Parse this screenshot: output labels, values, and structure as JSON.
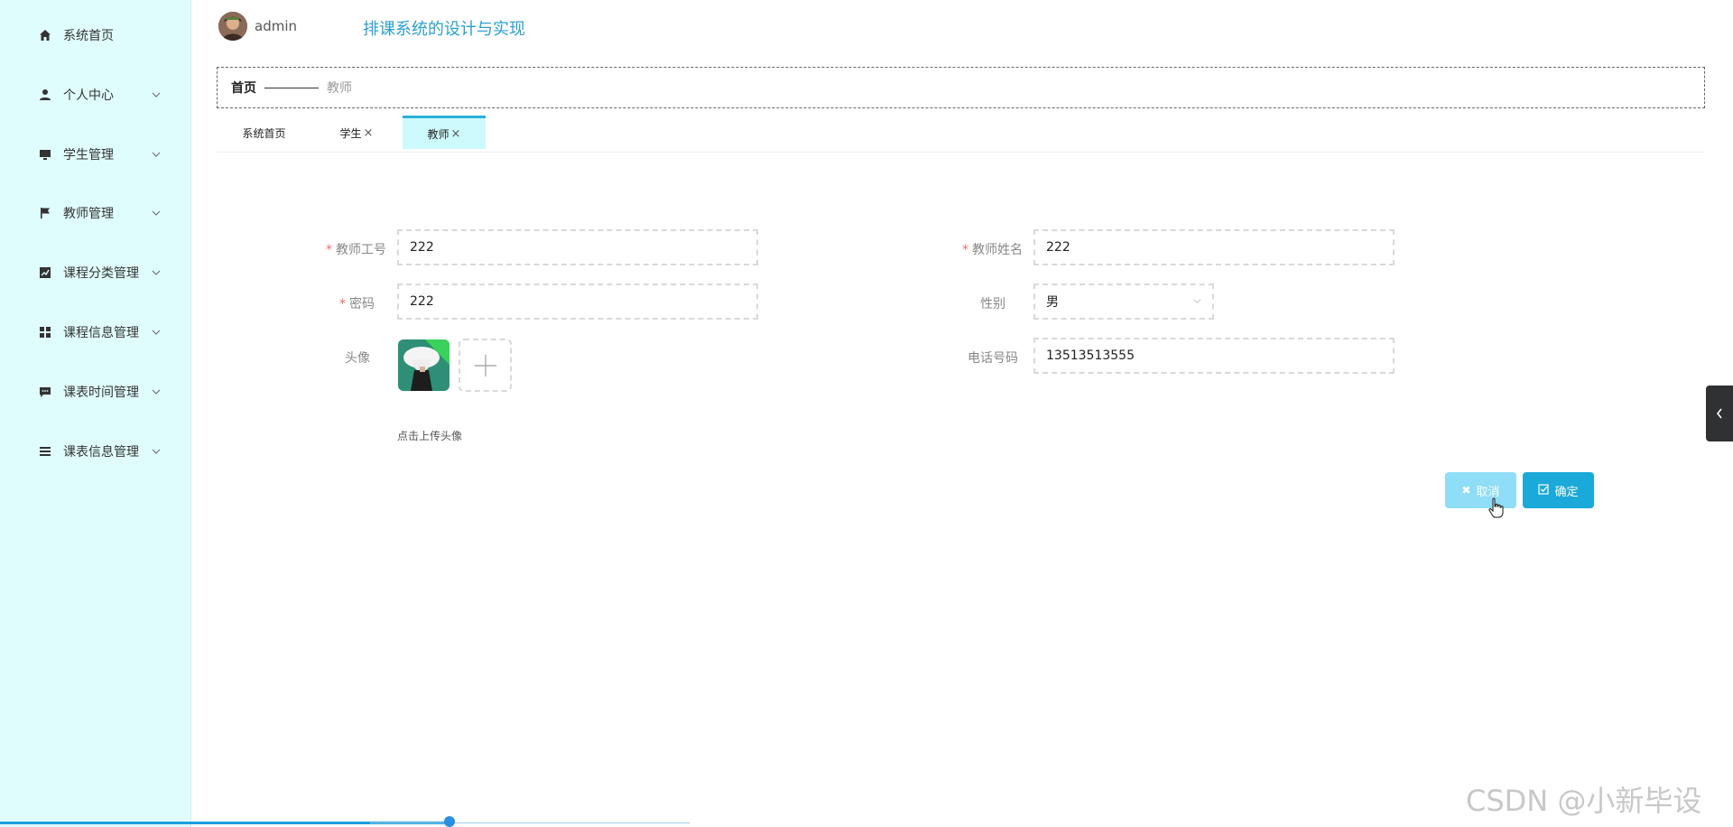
{
  "sidebar": {
    "items": [
      {
        "label": "系统首页",
        "icon": "home-icon",
        "has_submenu": false
      },
      {
        "label": "个人中心",
        "icon": "user-icon",
        "has_submenu": true
      },
      {
        "label": "学生管理",
        "icon": "monitor-icon",
        "has_submenu": true
      },
      {
        "label": "教师管理",
        "icon": "flag-icon",
        "has_submenu": true
      },
      {
        "label": "课程分类管理",
        "icon": "chart-icon",
        "has_submenu": true
      },
      {
        "label": "课程信息管理",
        "icon": "grid-icon",
        "has_submenu": true
      },
      {
        "label": "课表时间管理",
        "icon": "chat-icon",
        "has_submenu": true
      },
      {
        "label": "课表信息管理",
        "icon": "list-icon",
        "has_submenu": true
      }
    ]
  },
  "header": {
    "username": "admin",
    "title": "排课系统的设计与实现"
  },
  "breadcrumb": {
    "home": "首页",
    "current": "教师"
  },
  "tabs": [
    {
      "label": "系统首页",
      "closable": false,
      "active": false
    },
    {
      "label": "学生",
      "closable": true,
      "active": false
    },
    {
      "label": "教师",
      "closable": true,
      "active": true
    }
  ],
  "form": {
    "teacher_id": {
      "label": "教师工号",
      "value": "222",
      "required": true
    },
    "teacher_name": {
      "label": "教师姓名",
      "value": "222",
      "required": true
    },
    "password": {
      "label": "密码",
      "value": "222",
      "required": true
    },
    "gender": {
      "label": "性别",
      "value": "男"
    },
    "avatar": {
      "label": "头像",
      "hint": "点击上传头像"
    },
    "phone": {
      "label": "电话号码",
      "value": "13513513555"
    }
  },
  "buttons": {
    "cancel": "取消",
    "confirm": "确定"
  },
  "watermark": "CSDN @小新毕设",
  "colors": {
    "sidebar_bg": "#e0fdfe",
    "accent": "#1aa9d8",
    "title": "#2d9fd3",
    "active_tab": "#ccfafd",
    "required": "#f56c6c"
  }
}
